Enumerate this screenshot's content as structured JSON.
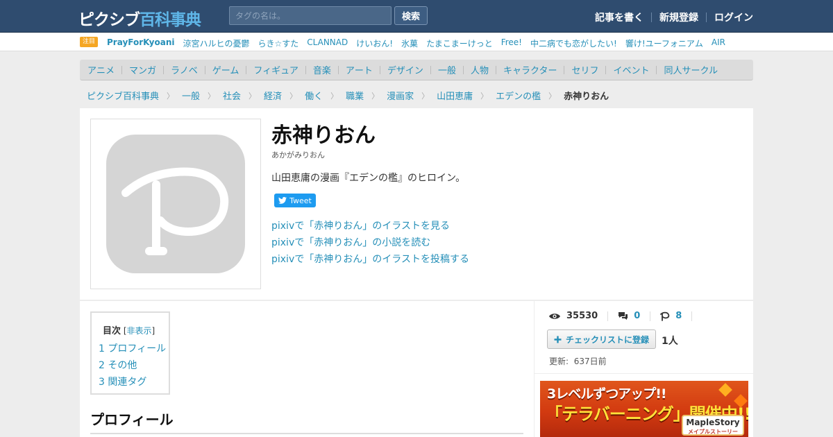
{
  "header": {
    "logo_kana": "ピクシブ",
    "logo_kanji": "百科事典",
    "search_placeholder": "タグの名は。",
    "search_button": "検索",
    "links": [
      "記事を書く",
      "新規登録",
      "ログイン"
    ]
  },
  "hotbar": {
    "badge": "注目",
    "tags": [
      "PrayForKyoani",
      "涼宮ハルヒの憂鬱",
      "らき☆すた",
      "CLANNAD",
      "けいおん!",
      "氷菓",
      "たまこまーけっと",
      "Free!",
      "中二病でも恋がしたい!",
      "響け!ユーフォニアム",
      "AIR"
    ]
  },
  "catnav": [
    "アニメ",
    "マンガ",
    "ラノベ",
    "ゲーム",
    "フィギュア",
    "音楽",
    "アート",
    "デザイン",
    "一般",
    "人物",
    "キャラクター",
    "セリフ",
    "イベント",
    "同人サークル"
  ],
  "breadcrumb": {
    "items": [
      "ピクシブ百科事典",
      "一般",
      "社会",
      "経済",
      "働く",
      "職業",
      "漫画家",
      "山田恵庸",
      "エデンの檻"
    ],
    "current": "赤神りおん"
  },
  "article": {
    "title": "赤神りおん",
    "reading": "あかがみりおん",
    "summary": "山田恵庸の漫画『エデンの檻』のヒロイン。",
    "tweet_label": "Tweet",
    "pixiv_links": [
      "pixivで「赤神りおん」のイラストを見る",
      "pixivで「赤神りおん」の小説を読む",
      "pixivで「赤神りおん」のイラストを投稿する"
    ]
  },
  "toc": {
    "label": "目次",
    "toggle": "非表示",
    "items": [
      "1 プロフィール",
      "2 その他",
      "3 関連タグ"
    ]
  },
  "section_heading": "プロフィール",
  "sidebar": {
    "views": "35530",
    "comments": "0",
    "pixiv_count": "8",
    "checklist_button": "チェックリストに登録",
    "checklist_count": "1人",
    "updated_label": "更新:",
    "updated_value": "637日前"
  },
  "ad": {
    "line1": "3レベルずつアップ!!",
    "line2": "「テラバーニング」開催中!!",
    "logo": "MapleStory",
    "logo_sub": "メイプルストーリー"
  },
  "colors": {
    "header_bg": "#2f4c6f",
    "link": "#258fb8",
    "logo_accent": "#5fb6e8",
    "badge": "#f5a623"
  }
}
